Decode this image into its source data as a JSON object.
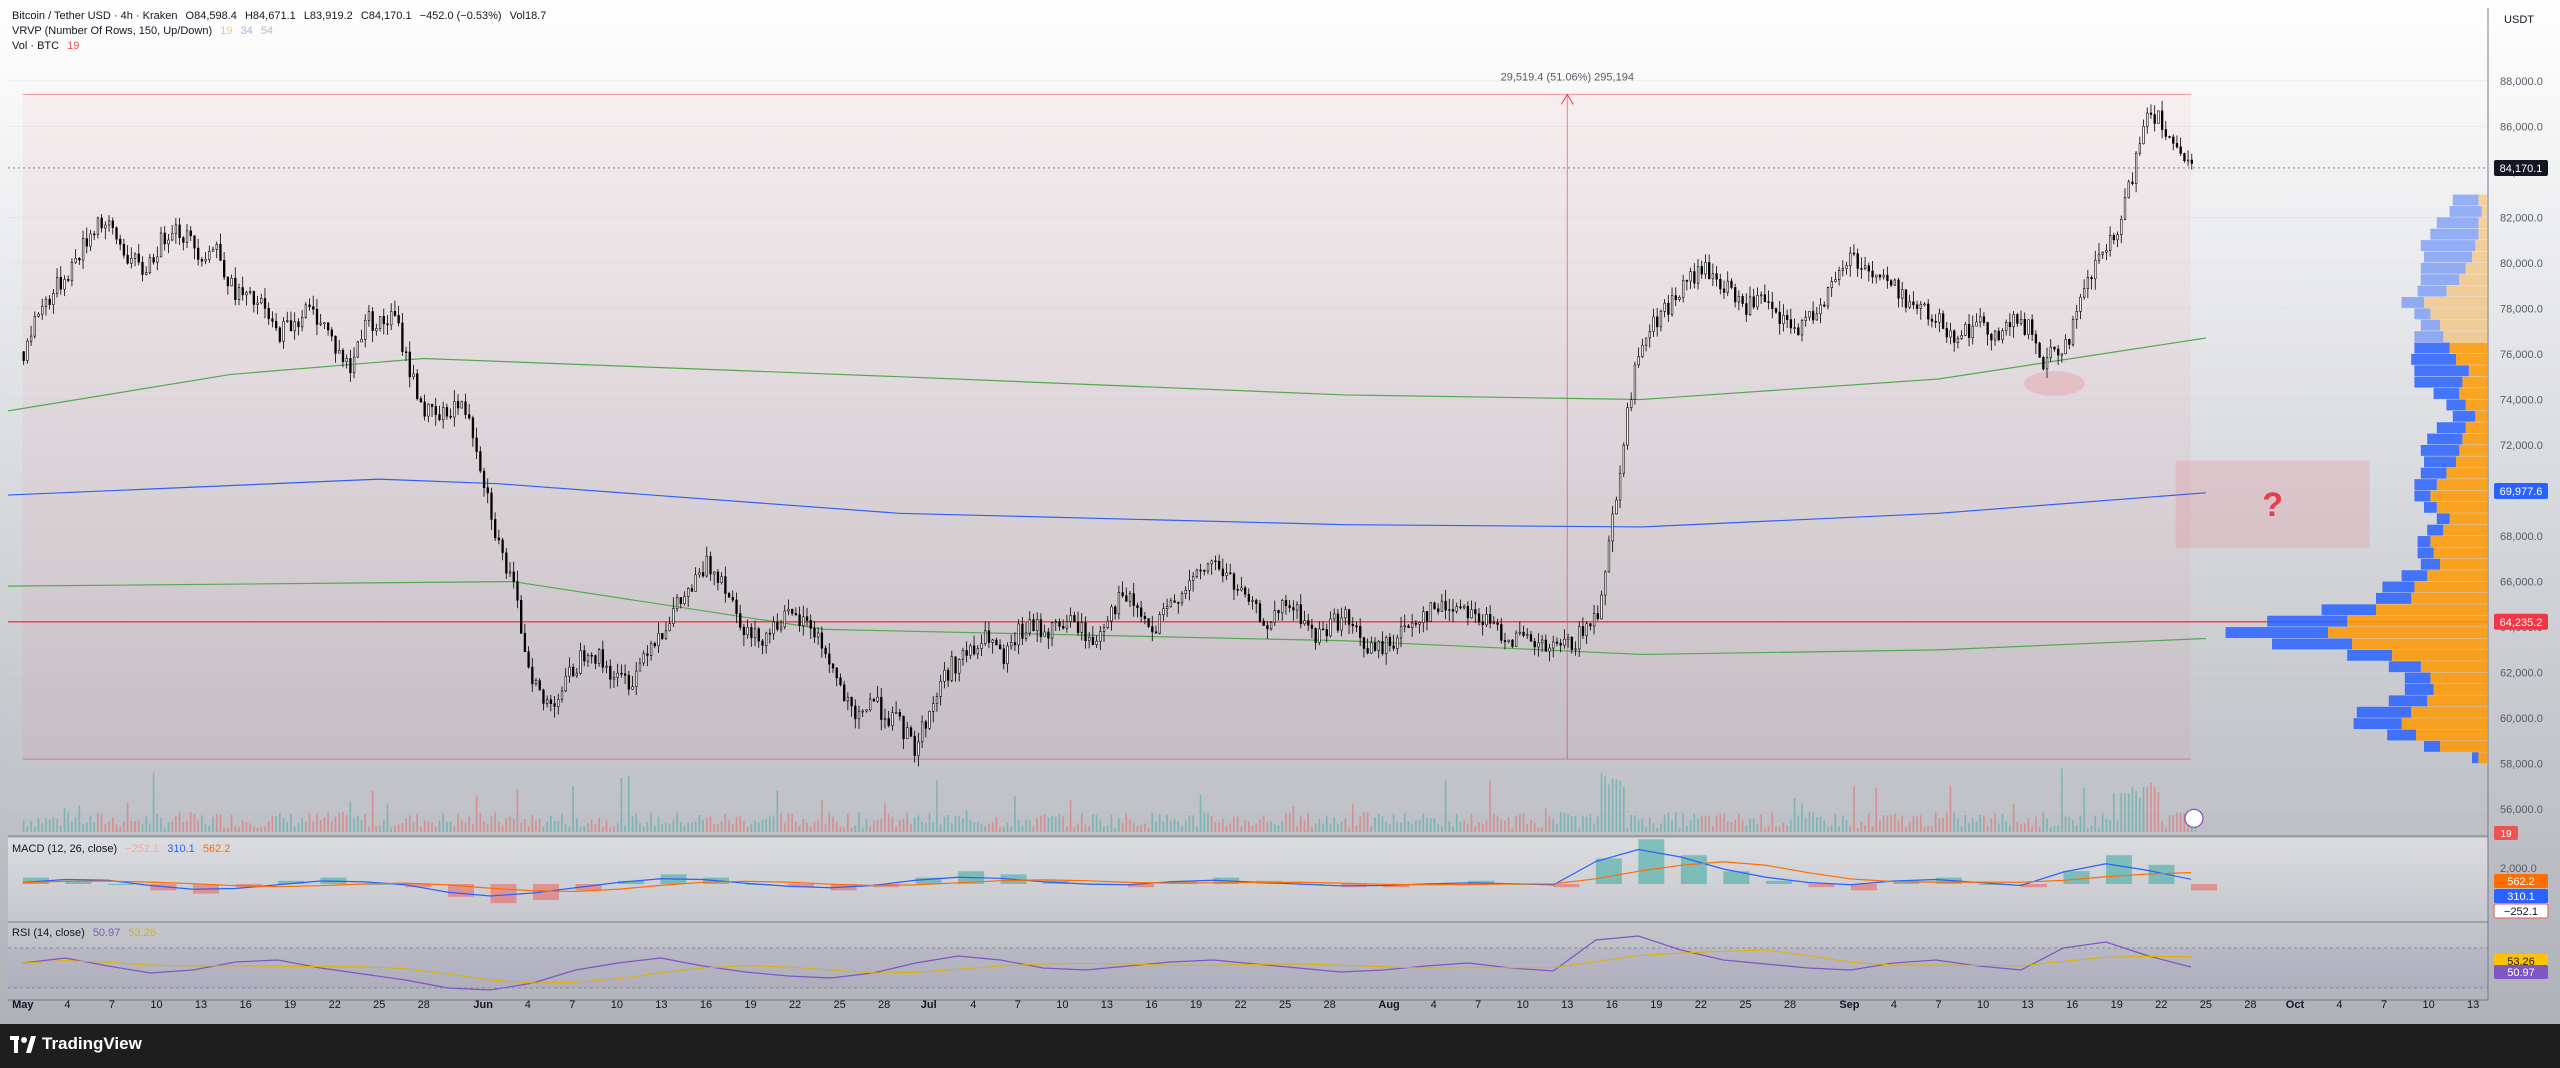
{
  "header": {
    "symbol": "Bitcoin / Tether USD · 4h · Kraken",
    "open": "O84,598.4",
    "high": "H84,671.1",
    "low": "L83,919.2",
    "close": "C84,170.1",
    "change": "−452.0 (−0.53%)",
    "volume": "Vol18.7",
    "vrvp_label": "VRVP (Number Of Rows, 150, Up/Down)",
    "vrvp_v1": "19",
    "vrvp_v2": "34",
    "vrvp_v3": "54",
    "vol_label": "Vol · BTC",
    "vol_value": "19",
    "currency": "USDT"
  },
  "macd": {
    "label": "MACD (12, 26, close)",
    "hist": "−252.1",
    "macd": "310.1",
    "signal": "562.2",
    "scale_label": "2,000.0"
  },
  "rsi": {
    "label": "RSI (14, close)",
    "rsi": "50.97",
    "ma": "53.26"
  },
  "measure": {
    "label": "29,519.4 (51.06%) 295,194"
  },
  "annotation": {
    "text": "?"
  },
  "price_tags": {
    "current": "84,170.1",
    "blue_ma": "69,977.6",
    "horizontal": "64,235.2",
    "vol": "19"
  },
  "brand": {
    "name": "TradingView"
  },
  "colors": {
    "up_volume": "#26a69a",
    "down_volume": "#ef5350",
    "ma_green": "#4caf50",
    "ma_blue": "#2962ff",
    "profile_up": "#2962ff",
    "profile_down": "#ff9800",
    "horizontal_line": "#f23645",
    "macd_line": "#2962ff",
    "signal_line": "#ff6d00",
    "rsi_line": "#7e57c2"
  },
  "chart_data": {
    "type": "candlestick",
    "price_axis": {
      "ylim": [
        55000,
        89000
      ],
      "ticks": [
        56000,
        58000,
        60000,
        62000,
        64000,
        66000,
        68000,
        70000,
        72000,
        74000,
        76000,
        78000,
        80000,
        82000,
        84000,
        86000,
        88000
      ],
      "tick_labels": [
        "56,000.0",
        "58,000.0",
        "60,000.0",
        "62,000.0",
        "64,000.0",
        "66,000.0",
        "68,000.0",
        "70,000.0",
        "72,000.0",
        "74,000.0",
        "76,000.0",
        "78,000.0",
        "80,000.0",
        "82,000.0",
        "84,000.0",
        "86,000.0",
        "88,000.0"
      ]
    },
    "time_axis": {
      "labels": [
        "May",
        "4",
        "7",
        "10",
        "13",
        "16",
        "19",
        "22",
        "25",
        "28",
        "Jun",
        "4",
        "7",
        "10",
        "13",
        "16",
        "19",
        "22",
        "25",
        "28",
        "Jul",
        "4",
        "7",
        "10",
        "13",
        "16",
        "19",
        "22",
        "25",
        "28",
        "Aug",
        "4",
        "7",
        "10",
        "13",
        "16",
        "19",
        "22",
        "25",
        "28",
        "Sep",
        "4",
        "7",
        "10",
        "13",
        "16",
        "19",
        "22",
        "25",
        "28",
        "Oct",
        "4",
        "7",
        "10",
        "13"
      ],
      "positions": [
        1,
        4,
        7,
        10,
        13,
        16,
        19,
        22,
        25,
        28,
        32,
        35,
        38,
        41,
        44,
        47,
        50,
        53,
        56,
        59,
        62,
        65,
        68,
        71,
        74,
        77,
        80,
        83,
        86,
        89,
        93,
        96,
        99,
        102,
        105,
        108,
        111,
        114,
        117,
        120,
        124,
        127,
        130,
        133,
        136,
        139,
        142,
        145,
        148,
        151,
        154,
        157,
        160,
        163,
        166
      ]
    },
    "close_series": [
      {
        "d": 1,
        "v": 76100
      },
      {
        "d": 2,
        "v": 77900
      },
      {
        "d": 3,
        "v": 78700
      },
      {
        "d": 4,
        "v": 79600
      },
      {
        "d": 5,
        "v": 80700
      },
      {
        "d": 6,
        "v": 81900
      },
      {
        "d": 7,
        "v": 81300
      },
      {
        "d": 8,
        "v": 80300
      },
      {
        "d": 9,
        "v": 79600
      },
      {
        "d": 10,
        "v": 80600
      },
      {
        "d": 11,
        "v": 81700
      },
      {
        "d": 12,
        "v": 81100
      },
      {
        "d": 13,
        "v": 80400
      },
      {
        "d": 14,
        "v": 80700
      },
      {
        "d": 15,
        "v": 78900
      },
      {
        "d": 16,
        "v": 78400
      },
      {
        "d": 17,
        "v": 78100
      },
      {
        "d": 18,
        "v": 76900
      },
      {
        "d": 19,
        "v": 77300
      },
      {
        "d": 20,
        "v": 77900
      },
      {
        "d": 21,
        "v": 77600
      },
      {
        "d": 22,
        "v": 76300
      },
      {
        "d": 23,
        "v": 75300
      },
      {
        "d": 24,
        "v": 77600
      },
      {
        "d": 25,
        "v": 77300
      },
      {
        "d": 26,
        "v": 77600
      },
      {
        "d": 27,
        "v": 75300
      },
      {
        "d": 28,
        "v": 73500
      },
      {
        "d": 29,
        "v": 73100
      },
      {
        "d": 30,
        "v": 73800
      },
      {
        "d": 31,
        "v": 73400
      },
      {
        "d": 32,
        "v": 70500
      },
      {
        "d": 33,
        "v": 67600
      },
      {
        "d": 34,
        "v": 65600
      },
      {
        "d": 35,
        "v": 62400
      },
      {
        "d": 36,
        "v": 60600
      },
      {
        "d": 37,
        "v": 61000
      },
      {
        "d": 38,
        "v": 62100
      },
      {
        "d": 39,
        "v": 63200
      },
      {
        "d": 40,
        "v": 62400
      },
      {
        "d": 41,
        "v": 61700
      },
      {
        "d": 42,
        "v": 61700
      },
      {
        "d": 43,
        "v": 63200
      },
      {
        "d": 44,
        "v": 63900
      },
      {
        "d": 45,
        "v": 64900
      },
      {
        "d": 46,
        "v": 65700
      },
      {
        "d": 47,
        "v": 66700
      },
      {
        "d": 48,
        "v": 66300
      },
      {
        "d": 49,
        "v": 64700
      },
      {
        "d": 50,
        "v": 63500
      },
      {
        "d": 51,
        "v": 63700
      },
      {
        "d": 52,
        "v": 64400
      },
      {
        "d": 53,
        "v": 64300
      },
      {
        "d": 54,
        "v": 64100
      },
      {
        "d": 55,
        "v": 62900
      },
      {
        "d": 56,
        "v": 61300
      },
      {
        "d": 57,
        "v": 59700
      },
      {
        "d": 58,
        "v": 60900
      },
      {
        "d": 59,
        "v": 60200
      },
      {
        "d": 60,
        "v": 59700
      },
      {
        "d": 61,
        "v": 58700
      },
      {
        "d": 62,
        "v": 60300
      },
      {
        "d": 63,
        "v": 61900
      },
      {
        "d": 64,
        "v": 62600
      },
      {
        "d": 65,
        "v": 62900
      },
      {
        "d": 66,
        "v": 63600
      },
      {
        "d": 67,
        "v": 62400
      },
      {
        "d": 68,
        "v": 63700
      },
      {
        "d": 69,
        "v": 64000
      },
      {
        "d": 70,
        "v": 63800
      },
      {
        "d": 71,
        "v": 64200
      },
      {
        "d": 72,
        "v": 64100
      },
      {
        "d": 73,
        "v": 63200
      },
      {
        "d": 74,
        "v": 64600
      },
      {
        "d": 75,
        "v": 65300
      },
      {
        "d": 76,
        "v": 64800
      },
      {
        "d": 77,
        "v": 63600
      },
      {
        "d": 78,
        "v": 64700
      },
      {
        "d": 79,
        "v": 65700
      },
      {
        "d": 80,
        "v": 66100
      },
      {
        "d": 81,
        "v": 66900
      },
      {
        "d": 82,
        "v": 66300
      },
      {
        "d": 83,
        "v": 65400
      },
      {
        "d": 84,
        "v": 64600
      },
      {
        "d": 85,
        "v": 64100
      },
      {
        "d": 86,
        "v": 65000
      },
      {
        "d": 87,
        "v": 64500
      },
      {
        "d": 88,
        "v": 63500
      },
      {
        "d": 89,
        "v": 64200
      },
      {
        "d": 90,
        "v": 64400
      },
      {
        "d": 91,
        "v": 63400
      },
      {
        "d": 92,
        "v": 62900
      },
      {
        "d": 93,
        "v": 63300
      },
      {
        "d": 94,
        "v": 63900
      },
      {
        "d": 95,
        "v": 64500
      },
      {
        "d": 96,
        "v": 64800
      },
      {
        "d": 97,
        "v": 64900
      },
      {
        "d": 98,
        "v": 65000
      },
      {
        "d": 99,
        "v": 64400
      },
      {
        "d": 100,
        "v": 64000
      },
      {
        "d": 101,
        "v": 63600
      },
      {
        "d": 102,
        "v": 63400
      },
      {
        "d": 103,
        "v": 63100
      },
      {
        "d": 104,
        "v": 63000
      },
      {
        "d": 105,
        "v": 63200
      },
      {
        "d": 106,
        "v": 63700
      },
      {
        "d": 107,
        "v": 64700
      },
      {
        "d": 108,
        "v": 68800
      },
      {
        "d": 109,
        "v": 73400
      },
      {
        "d": 110,
        "v": 76800
      },
      {
        "d": 111,
        "v": 77500
      },
      {
        "d": 112,
        "v": 78300
      },
      {
        "d": 113,
        "v": 79100
      },
      {
        "d": 114,
        "v": 79700
      },
      {
        "d": 115,
        "v": 79300
      },
      {
        "d": 116,
        "v": 78600
      },
      {
        "d": 117,
        "v": 78100
      },
      {
        "d": 118,
        "v": 78300
      },
      {
        "d": 119,
        "v": 77600
      },
      {
        "d": 120,
        "v": 77100
      },
      {
        "d": 121,
        "v": 77300
      },
      {
        "d": 122,
        "v": 78300
      },
      {
        "d": 123,
        "v": 79100
      },
      {
        "d": 124,
        "v": 80400
      },
      {
        "d": 125,
        "v": 79800
      },
      {
        "d": 126,
        "v": 79400
      },
      {
        "d": 127,
        "v": 78900
      },
      {
        "d": 128,
        "v": 78300
      },
      {
        "d": 129,
        "v": 77800
      },
      {
        "d": 130,
        "v": 77400
      },
      {
        "d": 131,
        "v": 76900
      },
      {
        "d": 132,
        "v": 77100
      },
      {
        "d": 133,
        "v": 77300
      },
      {
        "d": 134,
        "v": 76800
      },
      {
        "d": 135,
        "v": 77400
      },
      {
        "d": 136,
        "v": 77100
      },
      {
        "d": 137,
        "v": 75600
      },
      {
        "d": 138,
        "v": 76100
      },
      {
        "d": 139,
        "v": 77100
      },
      {
        "d": 140,
        "v": 79100
      },
      {
        "d": 141,
        "v": 80500
      },
      {
        "d": 142,
        "v": 81100
      },
      {
        "d": 143,
        "v": 83900
      },
      {
        "d": 144,
        "v": 86800
      },
      {
        "d": 145,
        "v": 86300
      },
      {
        "d": 146,
        "v": 84700
      },
      {
        "d": 147,
        "v": 84170
      }
    ],
    "horizontal_levels": [
      64235.2
    ],
    "moving_averages": [
      {
        "color": "#4caf50",
        "points": [
          {
            "d": 0,
            "v": 73500
          },
          {
            "d": 15,
            "v": 75100
          },
          {
            "d": 28,
            "v": 75800
          },
          {
            "d": 60,
            "v": 75000
          },
          {
            "d": 90,
            "v": 74200
          },
          {
            "d": 110,
            "v": 74000
          },
          {
            "d": 130,
            "v": 74900
          },
          {
            "d": 148,
            "v": 76700
          }
        ]
      },
      {
        "color": "#2962ff",
        "points": [
          {
            "d": 0,
            "v": 69800
          },
          {
            "d": 25,
            "v": 70500
          },
          {
            "d": 33,
            "v": 70300
          },
          {
            "d": 60,
            "v": 69000
          },
          {
            "d": 90,
            "v": 68500
          },
          {
            "d": 110,
            "v": 68400
          },
          {
            "d": 130,
            "v": 69000
          },
          {
            "d": 148,
            "v": 69900
          }
        ]
      },
      {
        "color": "#4caf50",
        "points": [
          {
            "d": 0,
            "v": 65800
          },
          {
            "d": 34,
            "v": 66000
          },
          {
            "d": 55,
            "v": 63900
          },
          {
            "d": 90,
            "v": 63400
          },
          {
            "d": 110,
            "v": 62800
          },
          {
            "d": 130,
            "v": 63000
          },
          {
            "d": 148,
            "v": 63500
          }
        ]
      }
    ],
    "measure": {
      "from": 58200,
      "to": 87400,
      "d": 105
    },
    "question_box": {
      "d1": 146,
      "d2": 159,
      "v_top": 71300,
      "v_bottom": 67500
    },
    "volume_profile": {
      "price_bins_from": 58000,
      "price_bins_step": 500,
      "down_lengths": [
        6,
        30,
        45,
        54,
        48,
        38,
        34,
        36,
        42,
        60,
        85,
        100,
        88,
        70,
        48,
        46,
        38,
        30,
        34,
        36,
        28,
        24,
        32,
        36,
        32,
        26,
        20,
        18,
        16,
        14,
        8,
        14,
        18,
        16,
        12,
        20,
        24,
        28,
        30,
        36,
        40,
        26,
        18,
        14,
        10,
        8,
        6,
        6,
        4,
        6
      ],
      "up_lengths": [
        4,
        10,
        18,
        30,
        34,
        24,
        18,
        16,
        20,
        28,
        50,
        64,
        50,
        34,
        22,
        20,
        16,
        12,
        10,
        8,
        10,
        8,
        8,
        10,
        14,
        16,
        20,
        24,
        22,
        18,
        14,
        12,
        16,
        30,
        34,
        28,
        22,
        18,
        12,
        10,
        14,
        18,
        24,
        28,
        30,
        34,
        30,
        26,
        20,
        16
      ]
    },
    "macd_series": {
      "hist": [
        2,
        1,
        0,
        -2,
        -3,
        -1,
        1,
        2,
        0,
        -1,
        -4,
        -6,
        -5,
        -2,
        1,
        3,
        2,
        0,
        -1,
        -2,
        -1,
        2,
        4,
        3,
        1,
        0,
        -1,
        1,
        2,
        1,
        0,
        -1,
        -1,
        0,
        1,
        0,
        -1,
        8,
        14,
        9,
        4,
        1,
        -1,
        -2,
        1,
        2,
        0,
        -1,
        4,
        9,
        6,
        -2
      ],
      "line": [
        100,
        300,
        250,
        -100,
        -350,
        -300,
        -50,
        200,
        150,
        -50,
        -550,
        -800,
        -600,
        -250,
        100,
        350,
        300,
        50,
        -150,
        -250,
        -100,
        250,
        450,
        380,
        150,
        0,
        -50,
        150,
        250,
        120,
        0,
        -120,
        -100,
        0,
        80,
        20,
        -60,
        1500,
        2300,
        1800,
        1000,
        450,
        100,
        -50,
        200,
        300,
        100,
        -100,
        800,
        1350,
        900,
        310
      ]
    },
    "rsi_series": [
      55,
      60,
      52,
      45,
      48,
      56,
      58,
      50,
      44,
      38,
      30,
      28,
      35,
      48,
      55,
      60,
      52,
      46,
      42,
      40,
      45,
      55,
      62,
      58,
      50,
      48,
      52,
      56,
      58,
      54,
      50,
      46,
      48,
      52,
      55,
      50,
      47,
      78,
      82,
      68,
      58,
      54,
      50,
      48,
      55,
      58,
      52,
      48,
      70,
      76,
      62,
      51
    ]
  }
}
